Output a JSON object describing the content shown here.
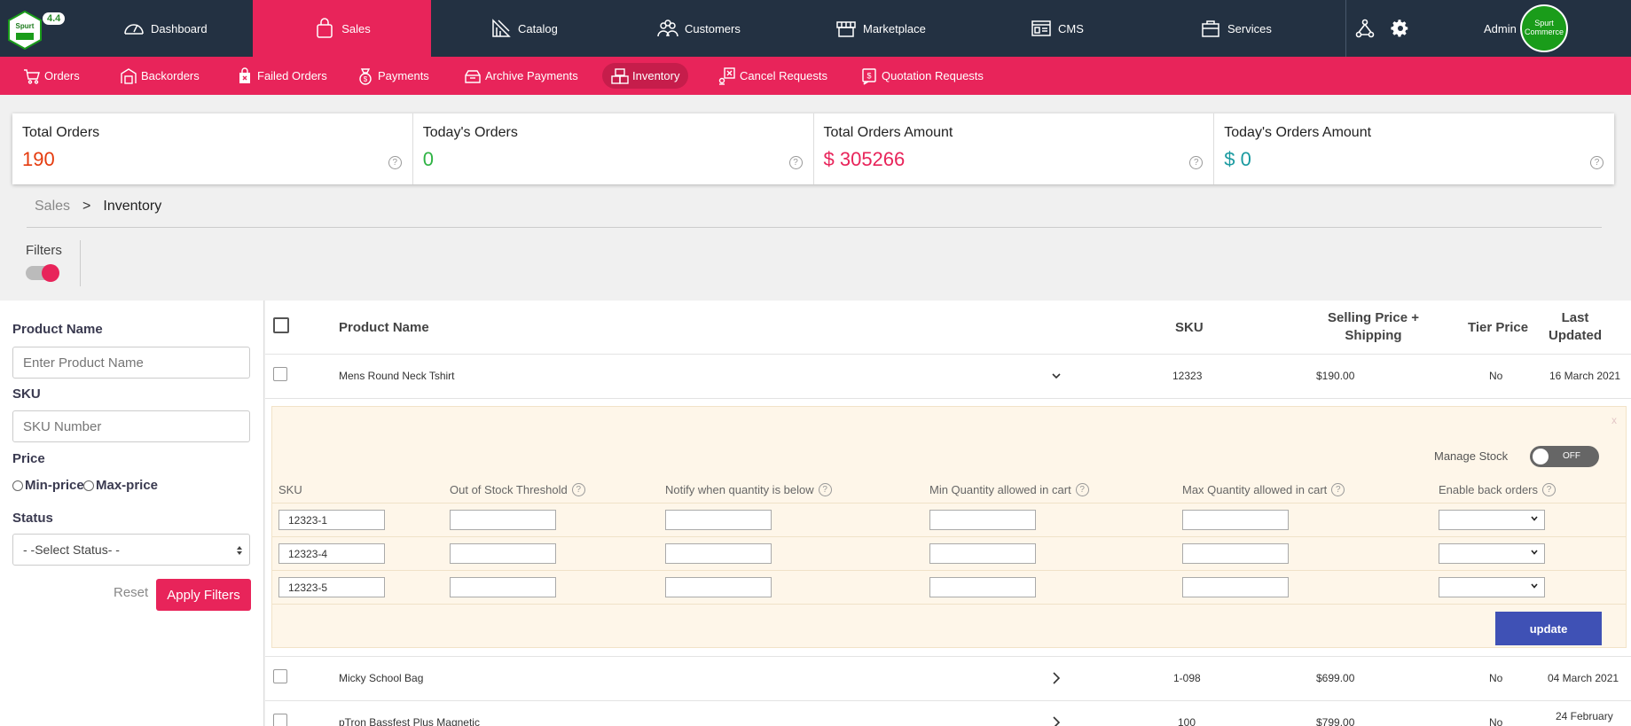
{
  "app": {
    "version": "4.4",
    "logo_text": "Spurt",
    "admin_label": "Admin",
    "avatar_text": "Spurt Commerce"
  },
  "topnav": [
    {
      "label": "Dashboard",
      "icon": "gauge-icon"
    },
    {
      "label": "Sales",
      "icon": "shopping-bag-icon",
      "active": true
    },
    {
      "label": "Catalog",
      "icon": "catalog-icon"
    },
    {
      "label": "Customers",
      "icon": "users-icon"
    },
    {
      "label": "Marketplace",
      "icon": "store-icon"
    },
    {
      "label": "CMS",
      "icon": "cms-icon"
    },
    {
      "label": "Services",
      "icon": "services-icon"
    }
  ],
  "subnav": [
    {
      "label": "Orders",
      "icon": "cart-icon"
    },
    {
      "label": "Backorders",
      "icon": "warehouse-icon"
    },
    {
      "label": "Failed Orders",
      "icon": "bag-x-icon"
    },
    {
      "label": "Payments",
      "icon": "payment-icon"
    },
    {
      "label": "Archive Payments",
      "icon": "archive-icon"
    },
    {
      "label": "Inventory",
      "icon": "boxes-icon",
      "active": true
    },
    {
      "label": "Cancel Requests",
      "icon": "cancel-request-icon"
    },
    {
      "label": "Quotation Requests",
      "icon": "quotation-icon"
    }
  ],
  "stats": [
    {
      "label": "Total Orders",
      "value": "190",
      "color": "#e53b0e"
    },
    {
      "label": "Today's Orders",
      "value": "0",
      "color": "#2fb344"
    },
    {
      "label": "Total Orders Amount",
      "value": "$ 305266",
      "color": "#e8245a"
    },
    {
      "label": "Today's Orders Amount",
      "value": "$ 0",
      "color": "#1a9aa0"
    }
  ],
  "breadcrumb": {
    "parent": "Sales",
    "separator": ">",
    "current": "Inventory"
  },
  "filters": {
    "title": "Filters",
    "product_name_label": "Product Name",
    "product_name_placeholder": "Enter Product Name",
    "sku_label": "SKU",
    "sku_placeholder": "SKU Number",
    "price_label": "Price",
    "min_price": "Min-price",
    "max_price": "Max-price",
    "status_label": "Status",
    "status_value": "- -Select Status- -",
    "reset": "Reset",
    "apply": "Apply Filters"
  },
  "table": {
    "headers": {
      "product_name": "Product Name",
      "sku": "SKU",
      "price_line1": "Selling Price +",
      "price_line2": "Shipping",
      "tier": "Tier Price",
      "updated_line1": "Last",
      "updated_line2": "Updated"
    },
    "rows": [
      {
        "name": "Mens Round Neck Tshirt",
        "sku": "12323",
        "price": "$190.00",
        "tier": "No",
        "updated": "16 March 2021"
      },
      {
        "name": "Micky School Bag",
        "sku": "1-098",
        "price": "$699.00",
        "tier": "No",
        "updated": "04 March 2021"
      },
      {
        "name": "pTron Bassfest Plus Magnetic",
        "sku": "100",
        "price": "$799.00",
        "tier": "No",
        "updated": "24 February"
      }
    ]
  },
  "expanded": {
    "close": "x",
    "manage_stock": "Manage Stock",
    "toggle": "OFF",
    "headers": {
      "sku": "SKU",
      "threshold": "Out of Stock Threshold",
      "notify": "Notify when quantity is below",
      "min_qty": "Min Quantity allowed in cart",
      "max_qty": "Max Quantity allowed in cart",
      "backorders": "Enable back orders"
    },
    "variants": [
      "12323-1",
      "12323-4",
      "12323-5"
    ],
    "update": "update"
  },
  "help_glyph": "?"
}
